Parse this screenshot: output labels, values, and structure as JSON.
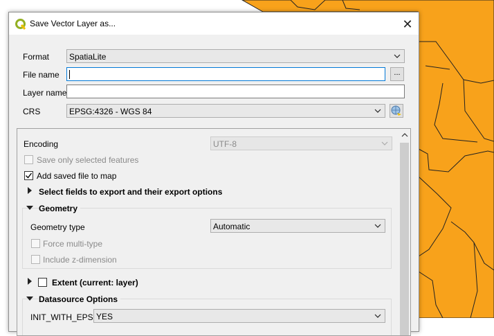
{
  "colors": {
    "map_fill": "#f8a21b",
    "map_stroke": "#222222",
    "accent": "#0078d7",
    "qgis_green": "#93b023"
  },
  "window": {
    "title": "Save Vector Layer as...",
    "close_glyph": "✕"
  },
  "form": {
    "format_label": "Format",
    "format_value": "SpatiaLite",
    "file_name_label": "File name",
    "file_name_value": "",
    "browse_label": "...",
    "layer_name_label": "Layer name",
    "layer_name_value": "",
    "crs_label": "CRS",
    "crs_value": "EPSG:4326 - WGS 84"
  },
  "options": {
    "encoding_label": "Encoding",
    "encoding_value": "UTF-8",
    "save_selected_label": "Save only selected features",
    "save_selected_checked": false,
    "add_to_map_label": "Add saved file to map",
    "add_to_map_checked": true,
    "select_fields_label": "Select fields to export and their export options",
    "geometry_group_label": "Geometry",
    "geometry_type_label": "Geometry type",
    "geometry_type_value": "Automatic",
    "force_multi_label": "Force multi-type",
    "include_z_label": "Include z-dimension",
    "extent_label": "Extent (current: layer)",
    "datasource_group_label": "Datasource Options",
    "init_with_epsg_label": "INIT_WITH_EPSG",
    "init_with_epsg_value": "YES"
  }
}
